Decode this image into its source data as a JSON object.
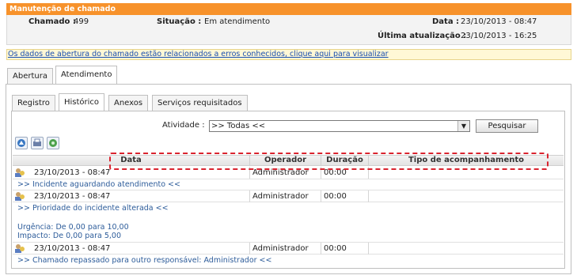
{
  "header": {
    "title": "Manutenção de chamado"
  },
  "info": {
    "chamado_label": "Chamado :",
    "chamado_value": "499",
    "situacao_label": "Situação :",
    "situacao_value": "Em atendimento",
    "data_label": "Data :",
    "data_value": "23/10/2013 - 08:47",
    "ultima_label": "Última atualização :",
    "ultima_value": "23/10/2013 - 16:25"
  },
  "notice": {
    "text": "Os dados de abertura do chamado estão relacionados a erros conhecidos, clique aqui para visualizar"
  },
  "outer_tabs": [
    {
      "label": "Abertura"
    },
    {
      "label": "Atendimento"
    }
  ],
  "inner_tabs": [
    {
      "label": "Registro"
    },
    {
      "label": "Histórico"
    },
    {
      "label": "Anexos"
    },
    {
      "label": "Serviços requisitados"
    }
  ],
  "filter": {
    "activity_label": "Atividade :",
    "activity_value": ">> Todas <<",
    "search_button": "Pesquisar"
  },
  "grid": {
    "columns": [
      "Data",
      "Operador",
      "Duração",
      "Tipo de acompanhamento"
    ],
    "rows": [
      {
        "data": "23/10/2013 - 08:47",
        "operador": "Administrador",
        "duracao": "00:00",
        "tipo": "",
        "detail": [
          ">> Incidente aguardando atendimento <<"
        ]
      },
      {
        "data": "23/10/2013 - 08:47",
        "operador": "Administrador",
        "duracao": "00:00",
        "tipo": "",
        "detail": [
          ">> Prioridade do incidente alterada <<",
          "",
          "Urgência: De 0,00 para 10,00",
          "Impacto: De 0,00 para 5,00"
        ]
      },
      {
        "data": "23/10/2013 - 08:47",
        "operador": "Administrador",
        "duracao": "00:00",
        "tipo": "",
        "detail": [
          ">> Chamado repassado para outro responsável: Administrador <<"
        ]
      }
    ]
  },
  "colors": {
    "header_orange": "#f7922b",
    "highlight_dash": "#d9232e",
    "detail_text": "#2d5c9a",
    "link": "#1a4fb0"
  }
}
